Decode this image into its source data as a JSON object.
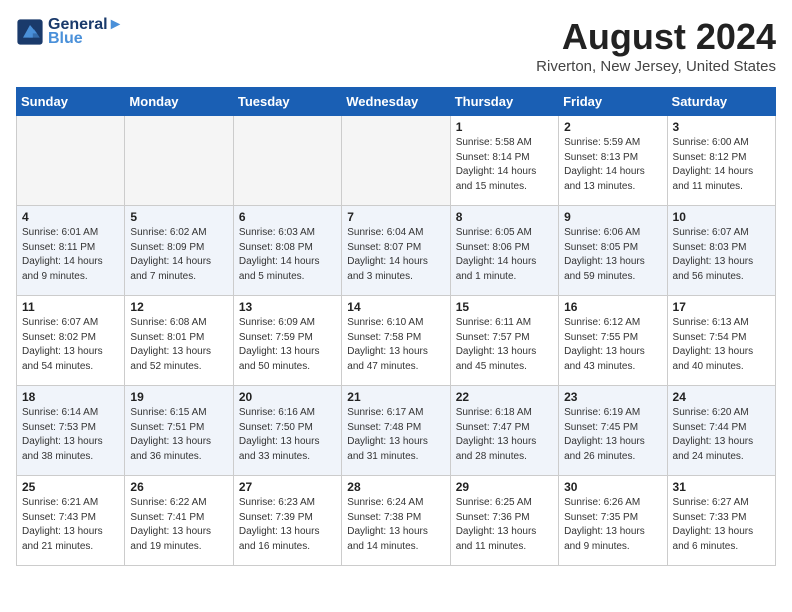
{
  "header": {
    "logo_line1": "General",
    "logo_line2": "Blue",
    "month_year": "August 2024",
    "location": "Riverton, New Jersey, United States"
  },
  "weekdays": [
    "Sunday",
    "Monday",
    "Tuesday",
    "Wednesday",
    "Thursday",
    "Friday",
    "Saturday"
  ],
  "weeks": [
    [
      {
        "day": "",
        "info": ""
      },
      {
        "day": "",
        "info": ""
      },
      {
        "day": "",
        "info": ""
      },
      {
        "day": "",
        "info": ""
      },
      {
        "day": "1",
        "info": "Sunrise: 5:58 AM\nSunset: 8:14 PM\nDaylight: 14 hours\nand 15 minutes."
      },
      {
        "day": "2",
        "info": "Sunrise: 5:59 AM\nSunset: 8:13 PM\nDaylight: 14 hours\nand 13 minutes."
      },
      {
        "day": "3",
        "info": "Sunrise: 6:00 AM\nSunset: 8:12 PM\nDaylight: 14 hours\nand 11 minutes."
      }
    ],
    [
      {
        "day": "4",
        "info": "Sunrise: 6:01 AM\nSunset: 8:11 PM\nDaylight: 14 hours\nand 9 minutes."
      },
      {
        "day": "5",
        "info": "Sunrise: 6:02 AM\nSunset: 8:09 PM\nDaylight: 14 hours\nand 7 minutes."
      },
      {
        "day": "6",
        "info": "Sunrise: 6:03 AM\nSunset: 8:08 PM\nDaylight: 14 hours\nand 5 minutes."
      },
      {
        "day": "7",
        "info": "Sunrise: 6:04 AM\nSunset: 8:07 PM\nDaylight: 14 hours\nand 3 minutes."
      },
      {
        "day": "8",
        "info": "Sunrise: 6:05 AM\nSunset: 8:06 PM\nDaylight: 14 hours\nand 1 minute."
      },
      {
        "day": "9",
        "info": "Sunrise: 6:06 AM\nSunset: 8:05 PM\nDaylight: 13 hours\nand 59 minutes."
      },
      {
        "day": "10",
        "info": "Sunrise: 6:07 AM\nSunset: 8:03 PM\nDaylight: 13 hours\nand 56 minutes."
      }
    ],
    [
      {
        "day": "11",
        "info": "Sunrise: 6:07 AM\nSunset: 8:02 PM\nDaylight: 13 hours\nand 54 minutes."
      },
      {
        "day": "12",
        "info": "Sunrise: 6:08 AM\nSunset: 8:01 PM\nDaylight: 13 hours\nand 52 minutes."
      },
      {
        "day": "13",
        "info": "Sunrise: 6:09 AM\nSunset: 7:59 PM\nDaylight: 13 hours\nand 50 minutes."
      },
      {
        "day": "14",
        "info": "Sunrise: 6:10 AM\nSunset: 7:58 PM\nDaylight: 13 hours\nand 47 minutes."
      },
      {
        "day": "15",
        "info": "Sunrise: 6:11 AM\nSunset: 7:57 PM\nDaylight: 13 hours\nand 45 minutes."
      },
      {
        "day": "16",
        "info": "Sunrise: 6:12 AM\nSunset: 7:55 PM\nDaylight: 13 hours\nand 43 minutes."
      },
      {
        "day": "17",
        "info": "Sunrise: 6:13 AM\nSunset: 7:54 PM\nDaylight: 13 hours\nand 40 minutes."
      }
    ],
    [
      {
        "day": "18",
        "info": "Sunrise: 6:14 AM\nSunset: 7:53 PM\nDaylight: 13 hours\nand 38 minutes."
      },
      {
        "day": "19",
        "info": "Sunrise: 6:15 AM\nSunset: 7:51 PM\nDaylight: 13 hours\nand 36 minutes."
      },
      {
        "day": "20",
        "info": "Sunrise: 6:16 AM\nSunset: 7:50 PM\nDaylight: 13 hours\nand 33 minutes."
      },
      {
        "day": "21",
        "info": "Sunrise: 6:17 AM\nSunset: 7:48 PM\nDaylight: 13 hours\nand 31 minutes."
      },
      {
        "day": "22",
        "info": "Sunrise: 6:18 AM\nSunset: 7:47 PM\nDaylight: 13 hours\nand 28 minutes."
      },
      {
        "day": "23",
        "info": "Sunrise: 6:19 AM\nSunset: 7:45 PM\nDaylight: 13 hours\nand 26 minutes."
      },
      {
        "day": "24",
        "info": "Sunrise: 6:20 AM\nSunset: 7:44 PM\nDaylight: 13 hours\nand 24 minutes."
      }
    ],
    [
      {
        "day": "25",
        "info": "Sunrise: 6:21 AM\nSunset: 7:43 PM\nDaylight: 13 hours\nand 21 minutes."
      },
      {
        "day": "26",
        "info": "Sunrise: 6:22 AM\nSunset: 7:41 PM\nDaylight: 13 hours\nand 19 minutes."
      },
      {
        "day": "27",
        "info": "Sunrise: 6:23 AM\nSunset: 7:39 PM\nDaylight: 13 hours\nand 16 minutes."
      },
      {
        "day": "28",
        "info": "Sunrise: 6:24 AM\nSunset: 7:38 PM\nDaylight: 13 hours\nand 14 minutes."
      },
      {
        "day": "29",
        "info": "Sunrise: 6:25 AM\nSunset: 7:36 PM\nDaylight: 13 hours\nand 11 minutes."
      },
      {
        "day": "30",
        "info": "Sunrise: 6:26 AM\nSunset: 7:35 PM\nDaylight: 13 hours\nand 9 minutes."
      },
      {
        "day": "31",
        "info": "Sunrise: 6:27 AM\nSunset: 7:33 PM\nDaylight: 13 hours\nand 6 minutes."
      }
    ]
  ]
}
